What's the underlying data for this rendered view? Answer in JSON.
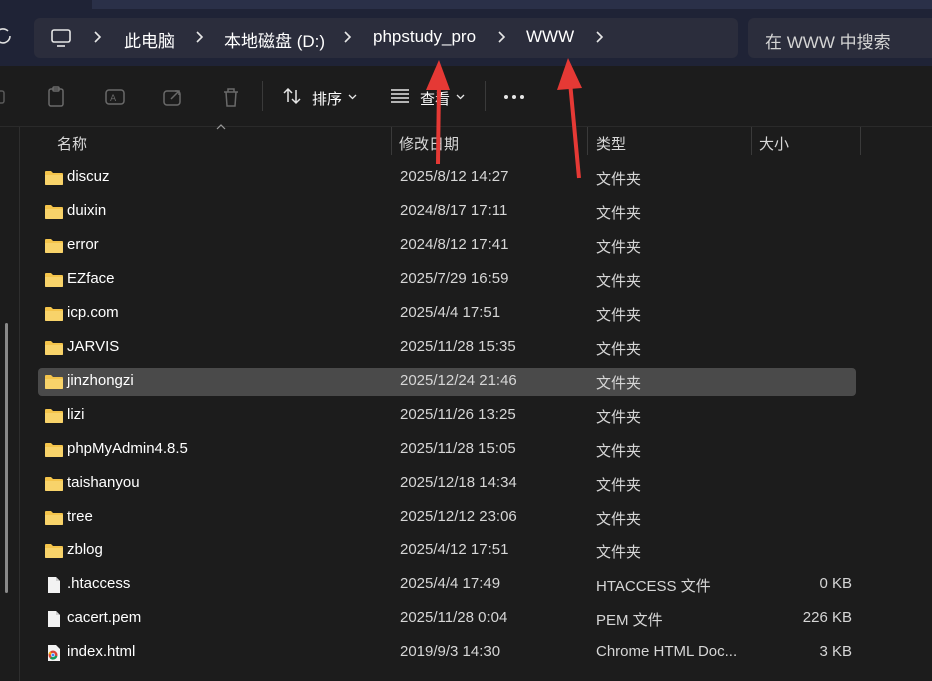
{
  "address_bar": {
    "breadcrumbs": [
      "此电脑",
      "本地磁盘 (D:)",
      "phpstudy_pro",
      "WWW"
    ]
  },
  "search": {
    "placeholder": "在 WWW 中搜索"
  },
  "toolbar": {
    "sort_label": "排序",
    "view_label": "查看"
  },
  "columns": {
    "name": "名称",
    "date": "修改日期",
    "type": "类型",
    "size": "大小"
  },
  "files": [
    {
      "name": "discuz",
      "date": "2025/8/12 14:27",
      "type": "文件夹",
      "size": "",
      "icon": "folder-icon"
    },
    {
      "name": "duixin",
      "date": "2024/8/17 17:11",
      "type": "文件夹",
      "size": "",
      "icon": "folder-icon"
    },
    {
      "name": "error",
      "date": "2024/8/12 17:41",
      "type": "文件夹",
      "size": "",
      "icon": "folder-icon"
    },
    {
      "name": "EZface",
      "date": "2025/7/29 16:59",
      "type": "文件夹",
      "size": "",
      "icon": "folder-icon"
    },
    {
      "name": "icp.com",
      "date": "2025/4/4 17:51",
      "type": "文件夹",
      "size": "",
      "icon": "folder-icon"
    },
    {
      "name": "JARVIS",
      "date": "2025/11/28 15:35",
      "type": "文件夹",
      "size": "",
      "icon": "folder-icon"
    },
    {
      "name": "jinzhongzi",
      "date": "2025/12/24 21:46",
      "type": "文件夹",
      "size": "",
      "icon": "folder-icon",
      "selected": true
    },
    {
      "name": "lizi",
      "date": "2025/11/26 13:25",
      "type": "文件夹",
      "size": "",
      "icon": "folder-icon"
    },
    {
      "name": "phpMyAdmin4.8.5",
      "date": "2025/11/28 15:05",
      "type": "文件夹",
      "size": "",
      "icon": "folder-icon"
    },
    {
      "name": "taishanyou",
      "date": "2025/12/18 14:34",
      "type": "文件夹",
      "size": "",
      "icon": "folder-icon"
    },
    {
      "name": "tree",
      "date": "2025/12/12 23:06",
      "type": "文件夹",
      "size": "",
      "icon": "folder-icon"
    },
    {
      "name": "zblog",
      "date": "2025/4/12 17:51",
      "type": "文件夹",
      "size": "",
      "icon": "folder-icon"
    },
    {
      "name": ".htaccess",
      "date": "2025/4/4 17:49",
      "type": "HTACCESS 文件",
      "size": "0 KB",
      "icon": "file-icon"
    },
    {
      "name": "cacert.pem",
      "date": "2025/11/28 0:04",
      "type": "PEM 文件",
      "size": "226 KB",
      "icon": "file-icon"
    },
    {
      "name": "index.html",
      "date": "2019/9/3 14:30",
      "type": "Chrome HTML Doc...",
      "size": "3 KB",
      "icon": "chrome-html-icon"
    }
  ],
  "colors": {
    "folder": "#f4c44b",
    "annotation_arrow": "#e53935",
    "selected_row": "#4a4a4a"
  }
}
